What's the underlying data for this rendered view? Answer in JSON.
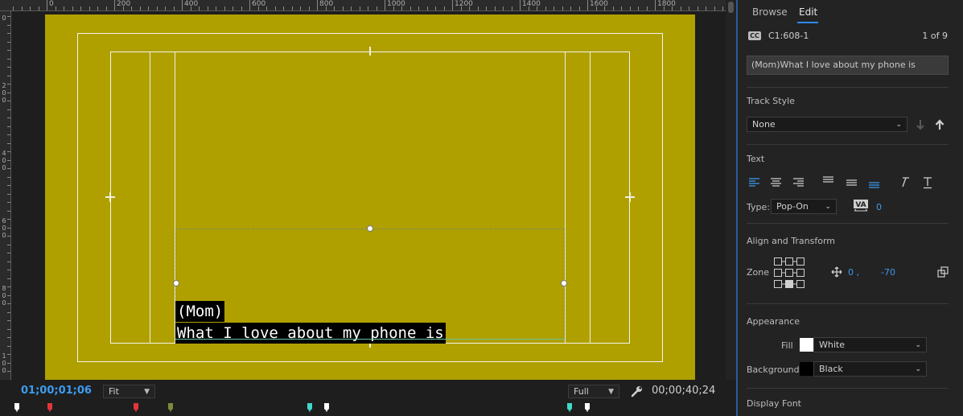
{
  "monitor": {
    "ruler_labels": [
      "0",
      "200",
      "400",
      "600",
      "800",
      "1000",
      "1200",
      "1400",
      "1600",
      "1800"
    ],
    "left_ruler_labels": [
      [
        "0"
      ],
      [
        "2",
        "0",
        "0"
      ],
      [
        "4",
        "0",
        "0"
      ],
      [
        "6",
        "0",
        "0"
      ],
      [
        "8",
        "0",
        "0"
      ],
      [
        "1",
        "0",
        "0"
      ]
    ],
    "caption_lines": [
      "(Mom)",
      "What I love about my phone is"
    ],
    "timecode_current": "01;00;01;06",
    "zoom_select": "Fit",
    "resolution_select": "Full",
    "timecode_duration": "00;00;40;24",
    "colors": {
      "frame": "#afa000",
      "timecode_accent": "#3d9cf0"
    }
  },
  "panel": {
    "tabs": [
      "Browse",
      "Edit"
    ],
    "active_tab": "Edit",
    "caption_id": "C1:608-1",
    "caption_count": "1 of 9",
    "caption_text": "(Mom)What I love about my phone is",
    "track_style": {
      "title": "Track Style",
      "value": "None"
    },
    "text": {
      "title": "Text",
      "type_label": "Type:",
      "type_value": "Pop-On",
      "kerning_value": "0"
    },
    "align_transform": {
      "title": "Align and Transform",
      "zone_label": "Zone",
      "x": "0 ,",
      "y": "-70"
    },
    "appearance": {
      "title": "Appearance",
      "fill_label": "Fill",
      "fill_value": "White",
      "background_label": "Background",
      "background_value": "Black"
    },
    "display_font": {
      "title": "Display Font"
    }
  }
}
